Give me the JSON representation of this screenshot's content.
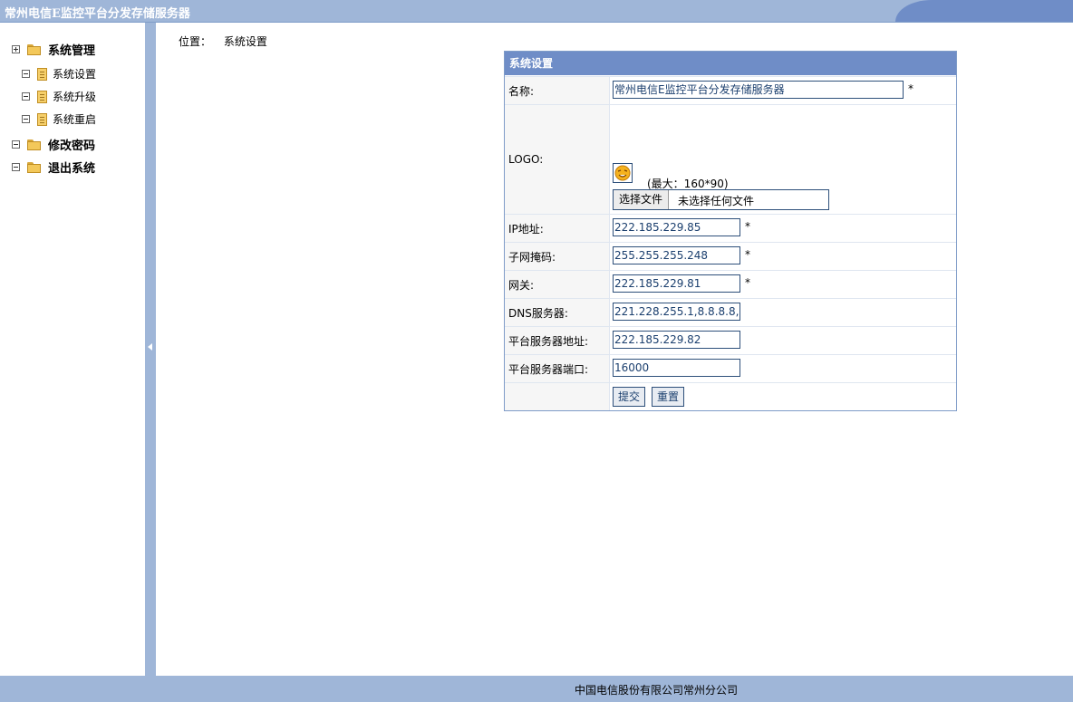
{
  "header": {
    "title": "常州电信E监控平台分发存储服务器"
  },
  "sidebar": {
    "items": [
      {
        "label": "系统管理",
        "icon": "folder-icon",
        "expander": "plus"
      },
      {
        "label": "系统设置",
        "icon": "document-icon",
        "expander": "minus"
      },
      {
        "label": "系统升级",
        "icon": "document-icon",
        "expander": "minus"
      },
      {
        "label": "系统重启",
        "icon": "document-icon",
        "expander": "minus"
      },
      {
        "label": "修改密码",
        "icon": "folder-icon",
        "expander": "minus"
      },
      {
        "label": "退出系统",
        "icon": "folder-icon",
        "expander": "minus"
      }
    ]
  },
  "location": {
    "label": "位置：",
    "value": "系统设置"
  },
  "form": {
    "title": "系统设置",
    "name": {
      "label": "名称:",
      "value": "常州电信E监控平台分发存储服务器",
      "required": "*"
    },
    "logo": {
      "label": "LOGO:",
      "max_hint": "(最大：160*90)",
      "choose_button": "选择文件",
      "file_status": "未选择任何文件"
    },
    "ip": {
      "label": "IP地址:",
      "value": "222.185.229.85",
      "required": "*"
    },
    "mask": {
      "label": "子网掩码:",
      "value": "255.255.255.248",
      "required": "*"
    },
    "gateway": {
      "label": "网关:",
      "value": "222.185.229.81",
      "required": "*"
    },
    "dns": {
      "label": "DNS服务器:",
      "value": "221.228.255.1,8.8.8.8,"
    },
    "server_addr": {
      "label": "平台服务器地址:",
      "value": "222.185.229.82"
    },
    "server_port": {
      "label": "平台服务器端口:",
      "value": "16000"
    },
    "submit_label": "提交",
    "reset_label": "重置"
  },
  "footer": {
    "text": "中国电信股份有限公司常州分公司"
  },
  "colors": {
    "header_bg": "#9fb6d8",
    "panel_head": "#6f8dc7",
    "input_border": "#2d4f7a"
  }
}
